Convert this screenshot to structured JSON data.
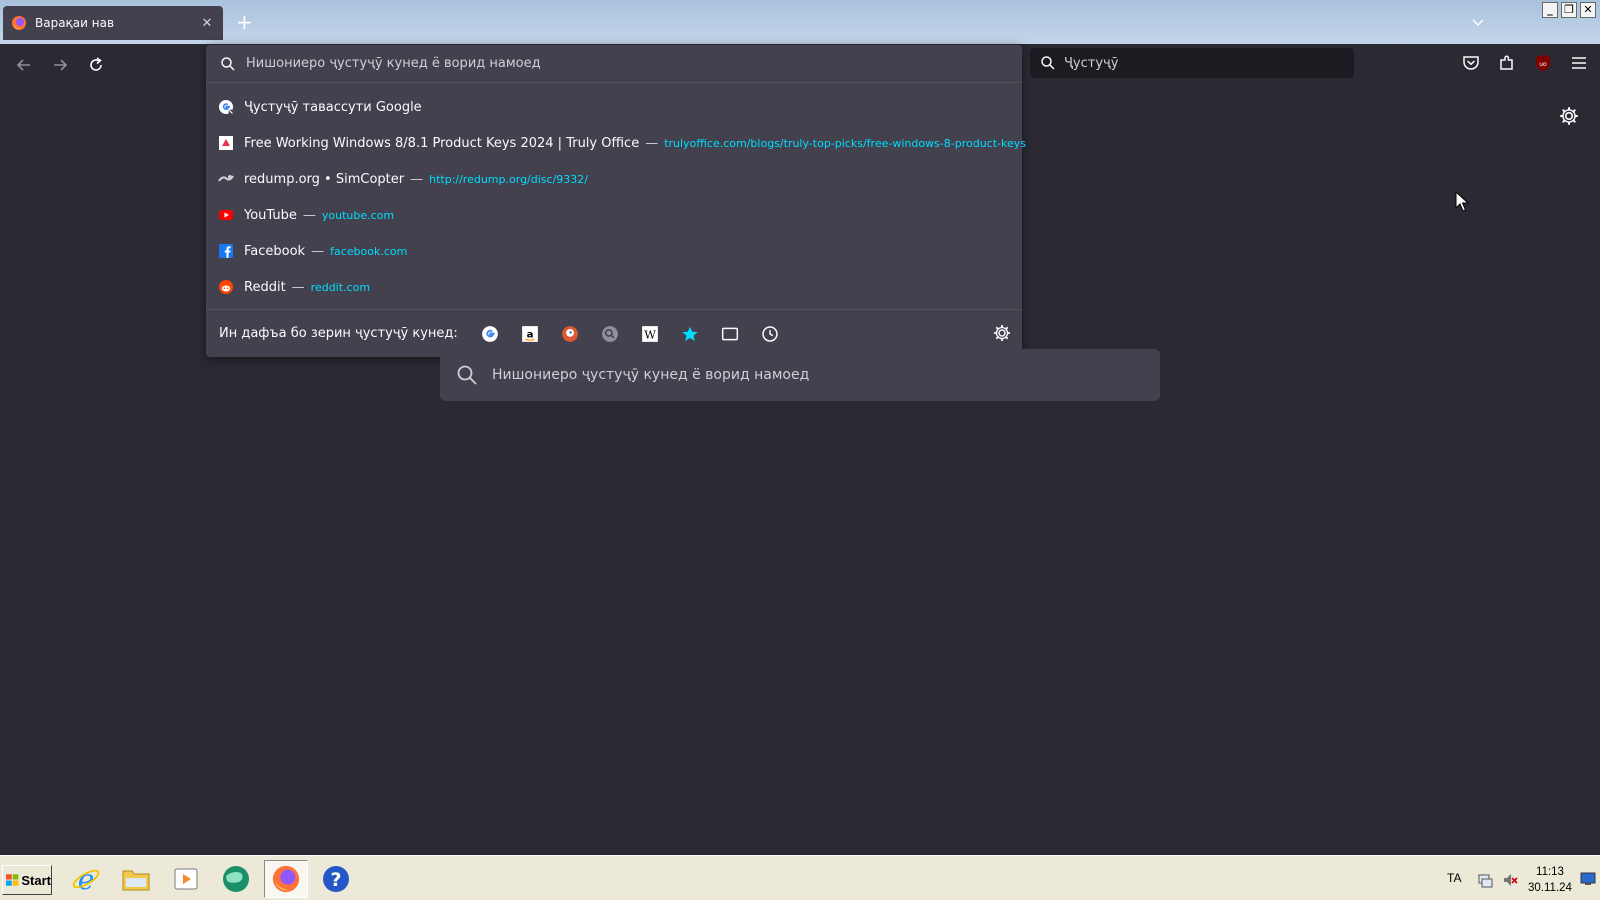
{
  "tab": {
    "title": "Варақаи нав"
  },
  "urlbar": {
    "placeholder": "Нишониеро ҷустуҷӯ кунед ё ворид намоед",
    "results": [
      {
        "label": "Ҷустуҷӯ тавассути Google",
        "url": "",
        "icon": "google-icon"
      },
      {
        "label": "Free Working Windows 8/8.1 Product Keys 2024 | Truly Office",
        "url": "trulyoffice.com/blogs/truly-top-picks/free-windows-8-product-keys",
        "icon": "trulyoffice-icon"
      },
      {
        "label": "redump.org • SimCopter",
        "url": "http://redump.org/disc/9332/",
        "icon": "redump-icon"
      },
      {
        "label": "YouTube",
        "url": "youtube.com",
        "icon": "youtube-icon"
      },
      {
        "label": "Facebook",
        "url": "facebook.com",
        "icon": "facebook-icon"
      },
      {
        "label": "Reddit",
        "url": "reddit.com",
        "icon": "reddit-icon"
      }
    ],
    "separator": "—",
    "oneoff_label": "Ин дафъа бо зерин ҷустуҷӯ кунед:",
    "engines": [
      "google-icon",
      "amazon-icon",
      "duckduckgo-icon",
      "search-engine-icon",
      "wikipedia-icon",
      "bookmarks-star-icon",
      "tabs-icon",
      "history-clock-icon"
    ]
  },
  "searchbar": {
    "placeholder": "Ҷустуҷӯ"
  },
  "content": {
    "search_placeholder": "Нишониеро ҷустуҷӯ кунед ё ворид намоед"
  },
  "taskbar": {
    "start_label": "Start",
    "apps": [
      "internet-explorer-icon",
      "file-explorer-icon",
      "media-player-icon",
      "green-globe-icon",
      "firefox-icon",
      "help-icon"
    ],
    "language": "TA",
    "time": "11:13",
    "date": "30.11.24"
  },
  "colors": {
    "accent_url": "#00ddff",
    "panel": "#42414d",
    "background": "#2b2a33"
  }
}
